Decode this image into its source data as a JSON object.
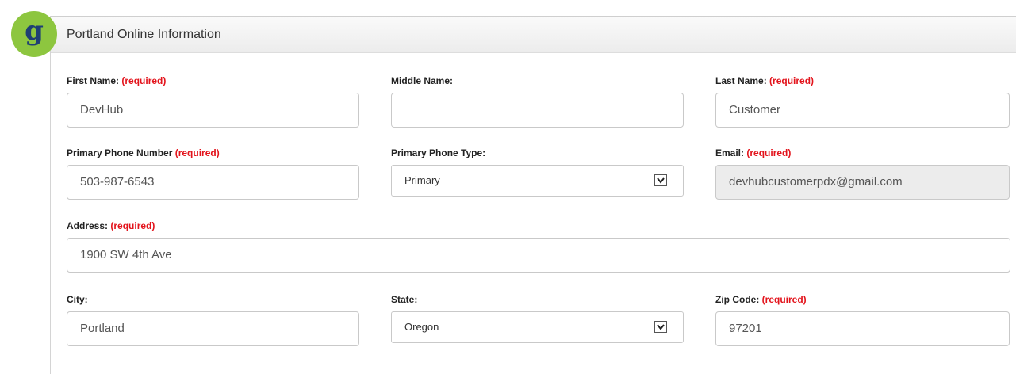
{
  "logo": {
    "letter": "g"
  },
  "panel": {
    "title": "Portland Online Information"
  },
  "form": {
    "required_text": "(required)",
    "first_name": {
      "label": "First Name:",
      "value": "DevHub"
    },
    "middle_name": {
      "label": "Middle Name:",
      "value": ""
    },
    "last_name": {
      "label": "Last Name:",
      "value": "Customer"
    },
    "primary_phone": {
      "label": "Primary Phone Number",
      "value": "503-987-6543"
    },
    "phone_type": {
      "label": "Primary Phone Type:",
      "value": "Primary"
    },
    "email": {
      "label": "Email:",
      "value": "devhubcustomerpdx@gmail.com"
    },
    "address": {
      "label": "Address:",
      "value": "1900 SW 4th Ave"
    },
    "city": {
      "label": "City:",
      "value": "Portland"
    },
    "state": {
      "label": "State:",
      "value": "Oregon"
    },
    "zip": {
      "label": "Zip Code:",
      "value": "97201"
    }
  },
  "icons": {
    "dropdown": "chevron-down-icon"
  },
  "colors": {
    "logo_bg": "#8dc63f",
    "logo_letter": "#1e3f74",
    "required": "#e3141c",
    "disabled_bg": "#ececec"
  }
}
